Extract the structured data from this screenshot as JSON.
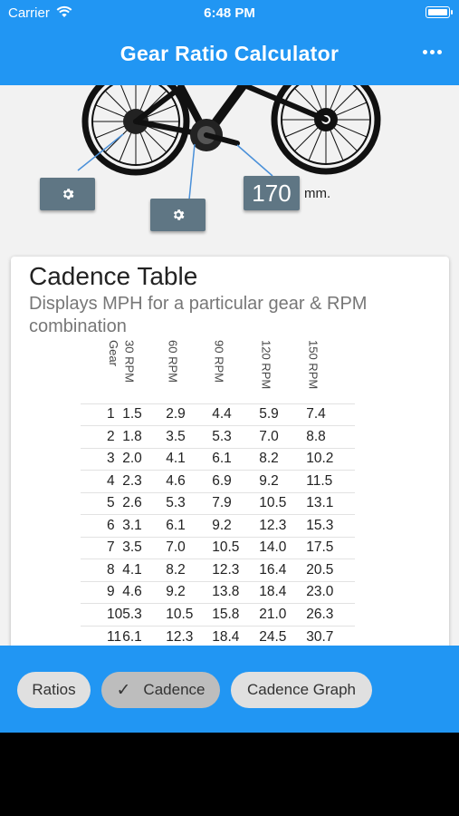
{
  "status_bar": {
    "carrier": "Carrier",
    "time": "6:48 PM"
  },
  "header": {
    "title": "Gear Ratio Calculator"
  },
  "crank": {
    "value": "170",
    "unit": "mm."
  },
  "card": {
    "title": "Cadence Table",
    "subtitle": "Displays MPH for a particular gear & RPM combination",
    "headers": [
      "Gear",
      "30 RPM",
      "60 RPM",
      "90 RPM",
      "120 RPM",
      "150 RPM"
    ],
    "rows": [
      [
        "1",
        "1.5",
        "2.9",
        "4.4",
        "5.9",
        "7.4"
      ],
      [
        "2",
        "1.8",
        "3.5",
        "5.3",
        "7.0",
        "8.8"
      ],
      [
        "3",
        "2.0",
        "4.1",
        "6.1",
        "8.2",
        "10.2"
      ],
      [
        "4",
        "2.3",
        "4.6",
        "6.9",
        "9.2",
        "11.5"
      ],
      [
        "5",
        "2.6",
        "5.3",
        "7.9",
        "10.5",
        "13.1"
      ],
      [
        "6",
        "3.1",
        "6.1",
        "9.2",
        "12.3",
        "15.3"
      ],
      [
        "7",
        "3.5",
        "7.0",
        "10.5",
        "14.0",
        "17.5"
      ],
      [
        "8",
        "4.1",
        "8.2",
        "12.3",
        "16.4",
        "20.5"
      ],
      [
        "9",
        "4.6",
        "9.2",
        "13.8",
        "18.4",
        "23.0"
      ],
      [
        "10",
        "5.3",
        "10.5",
        "15.8",
        "21.0",
        "26.3"
      ],
      [
        "11",
        "6.1",
        "12.3",
        "18.4",
        "24.5",
        "30.7"
      ]
    ]
  },
  "bottom_tabs": [
    {
      "label": "Ratios",
      "selected": false
    },
    {
      "label": "Cadence",
      "selected": true
    },
    {
      "label": "Cadence Graph",
      "selected": false
    }
  ],
  "colors": {
    "primary": "#2196f3",
    "button": "#5f7684"
  },
  "icons": [
    "wifi-icon",
    "battery-icon",
    "more-horizontal-icon",
    "gear-icon",
    "check-icon"
  ]
}
